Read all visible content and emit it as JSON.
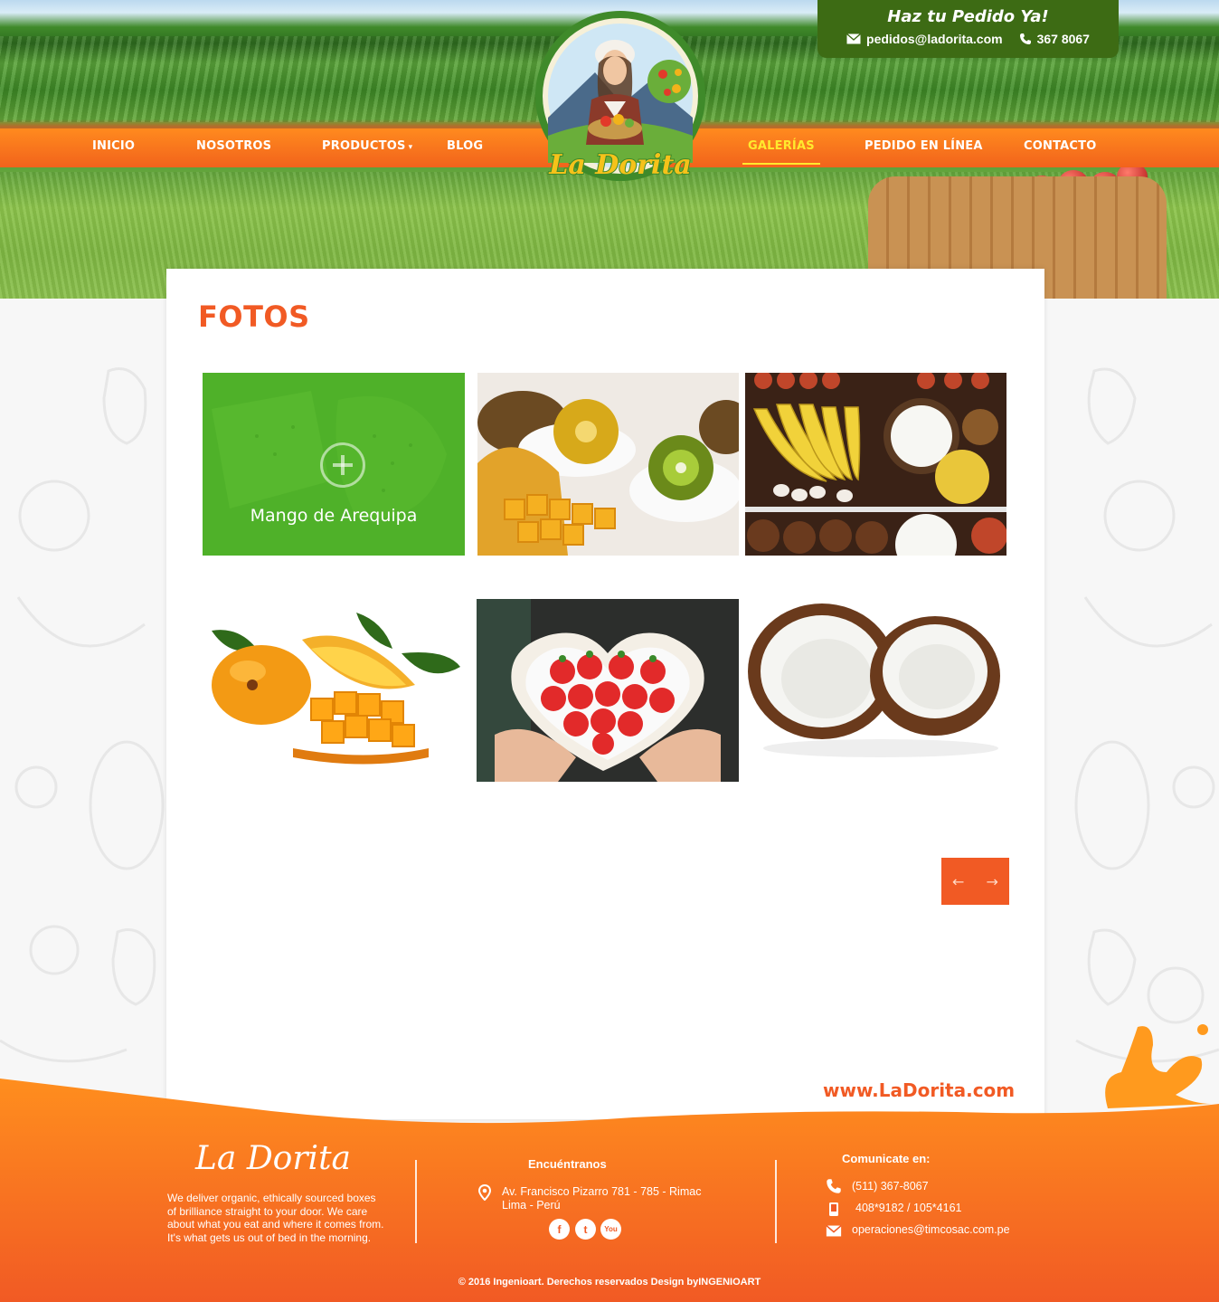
{
  "order": {
    "title": "Haz tu Pedido Ya!",
    "email": "pedidos@ladorita.com",
    "phone": "367 8067"
  },
  "nav": {
    "items": [
      {
        "label": "INICIO"
      },
      {
        "label": "NOSOTROS"
      },
      {
        "label": "PRODUCTOS"
      },
      {
        "label": "BLOG"
      },
      {
        "label": "GALERÍAS"
      },
      {
        "label": "PEDIDO EN LÍNEA"
      },
      {
        "label": "CONTACTO"
      }
    ],
    "caret": "▾",
    "active": "GALERÍAS"
  },
  "logo": {
    "text": "La Dorita"
  },
  "gallery": {
    "title": "FOTOS",
    "items": [
      {
        "caption": "Mango de Arequipa",
        "subject": "mango-slices",
        "hovered": true
      },
      {
        "subject": "kiwi-and-mango"
      },
      {
        "subject": "fruit-market"
      },
      {
        "subject": "mango"
      },
      {
        "subject": "strawberries-heart-bowl"
      },
      {
        "subject": "coconut"
      }
    ],
    "prev_label": "←",
    "next_label": "→"
  },
  "site_url": "www.LaDorita.com",
  "footer": {
    "brand": "La Dorita",
    "description": "We deliver organic, ethically sourced boxes of brilliance straight to your door. We care about what you eat and where it comes from. It's what gets us out of bed in the morning.",
    "find_us": {
      "heading": "Encuéntranos",
      "address_line1": "Av. Francisco Pizarro 781 - 785 - Rimac",
      "address_line2": "Lima - Perú",
      "social": [
        "f",
        "t",
        "You"
      ]
    },
    "contact": {
      "heading": "Comunicate en:",
      "phone": "(511) 367-8067",
      "mobile": "408*9182 / 105*4161",
      "email": "operaciones@timcosac.com.pe"
    },
    "copyright": "© 2016 Ingenioart. Derechos reservados Design byINGENIOART"
  },
  "colors": {
    "accent": "#f15a24",
    "nav_orange": "#ff8a1e",
    "active": "#ffe92e",
    "order_green": "#3d6b14",
    "overlay_green": "#50b428"
  }
}
